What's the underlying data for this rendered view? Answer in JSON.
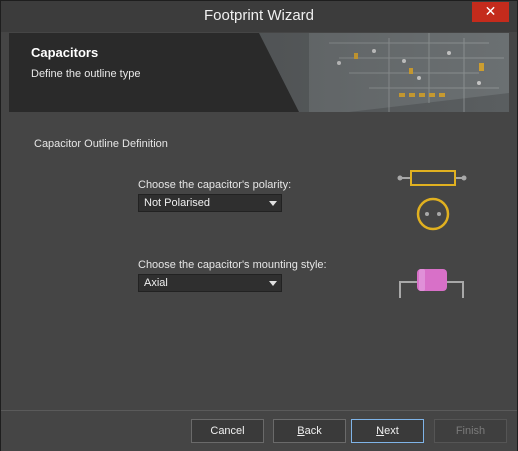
{
  "window": {
    "title": "Footprint Wizard",
    "close_glyph": "✕"
  },
  "banner": {
    "title": "Capacitors",
    "subtitle": "Define the outline type"
  },
  "content": {
    "section_title": "Capacitor Outline Definition",
    "polarity": {
      "label": "Choose the capacitor's polarity:",
      "value": "Not Polarised"
    },
    "mounting": {
      "label": "Choose the capacitor's mounting style:",
      "value": "Axial"
    }
  },
  "buttons": {
    "cancel": "Cancel",
    "back_prefix": "",
    "back_ul": "B",
    "back_rest": "ack",
    "next_ul": "N",
    "next_rest": "ext",
    "finish": "Finish"
  },
  "icons": {
    "close": "close-icon",
    "polarity_preview": "non-polarised-capacitor-icon",
    "mounting_preview": "axial-capacitor-icon"
  },
  "colors": {
    "accent_gold": "#e0b020",
    "axial_body": "#d870c8",
    "primary_border": "#7fb4e8",
    "close_red": "#c42b1c"
  }
}
